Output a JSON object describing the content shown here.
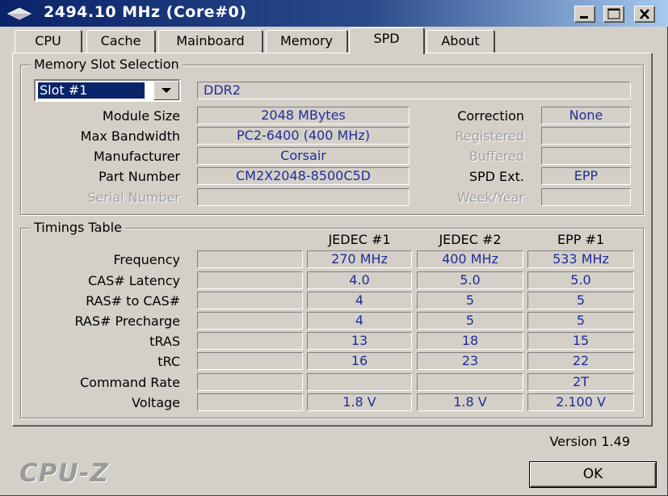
{
  "title_bar": {
    "title": "2494.10 MHz (Core#0)"
  },
  "tabs": [
    {
      "label": "CPU"
    },
    {
      "label": "Cache"
    },
    {
      "label": "Mainboard"
    },
    {
      "label": "Memory"
    },
    {
      "label": "SPD",
      "active": true
    },
    {
      "label": "About"
    }
  ],
  "slot_section": {
    "title": "Memory Slot Selection",
    "slot_selected": "Slot #1",
    "memory_type": "DDR2",
    "labels": {
      "module_size": "Module Size",
      "max_bandwidth": "Max Bandwidth",
      "manufacturer": "Manufacturer",
      "part_number": "Part Number",
      "serial_number": "Serial Number",
      "correction": "Correction",
      "registered": "Registered",
      "buffered": "Buffered",
      "spd_ext": "SPD Ext.",
      "week_year": "Week/Year"
    },
    "values": {
      "module_size": "2048 MBytes",
      "max_bandwidth": "PC2-6400 (400 MHz)",
      "manufacturer": "Corsair",
      "part_number": "CM2X2048-8500C5D",
      "serial_number": "",
      "correction": "None",
      "registered": "",
      "buffered": "",
      "spd_ext": "EPP",
      "week_year": ""
    }
  },
  "timings": {
    "title": "Timings Table",
    "columns": [
      "JEDEC #1",
      "JEDEC #2",
      "EPP #1"
    ],
    "rows": [
      {
        "label": "Frequency",
        "values": [
          "270 MHz",
          "400 MHz",
          "533 MHz"
        ]
      },
      {
        "label": "CAS# Latency",
        "values": [
          "4.0",
          "5.0",
          "5.0"
        ]
      },
      {
        "label": "RAS# to CAS#",
        "values": [
          "4",
          "5",
          "5"
        ]
      },
      {
        "label": "RAS# Precharge",
        "values": [
          "4",
          "5",
          "5"
        ]
      },
      {
        "label": "tRAS",
        "values": [
          "13",
          "18",
          "15"
        ]
      },
      {
        "label": "tRC",
        "values": [
          "16",
          "23",
          "22"
        ]
      },
      {
        "label": "Command Rate",
        "values": [
          "",
          "",
          "2T"
        ]
      },
      {
        "label": "Voltage",
        "values": [
          "1.8 V",
          "1.8 V",
          "2.100 V"
        ]
      }
    ]
  },
  "footer": {
    "version": "Version 1.49",
    "brand": "CPU-Z",
    "ok_label": "OK"
  },
  "icons": [
    "app-icon",
    "minimize-icon",
    "maximize-icon",
    "close-icon",
    "dropdown-arrow-icon"
  ],
  "colors": {
    "titlebar_start": "#0a246a",
    "titlebar_end": "#a6caf0",
    "window_bg": "#d4d0c8",
    "value_text": "#1f2d9a",
    "disabled_text": "#a0a0a0"
  }
}
